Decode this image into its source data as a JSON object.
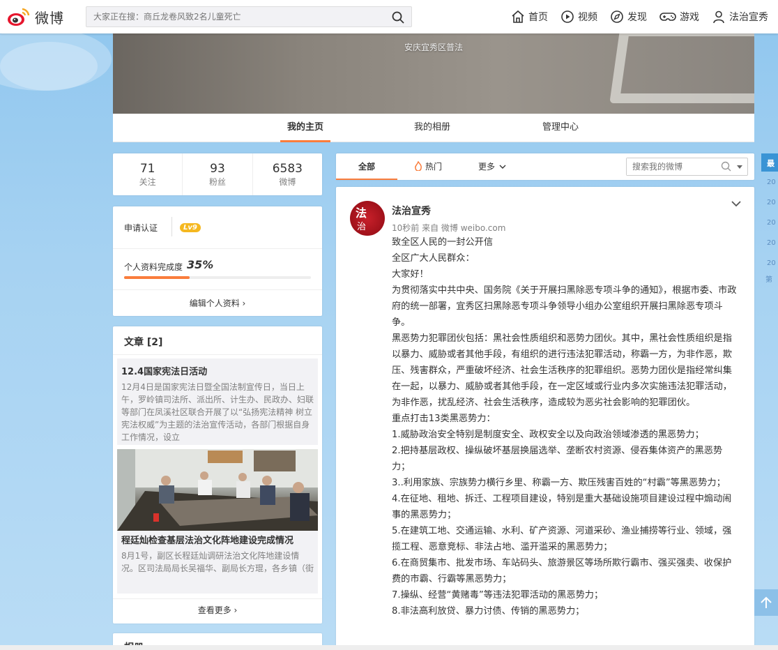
{
  "topbar": {
    "logo_text": "微博",
    "search_placeholder": "大家正在搜：商丘龙卷风致2名儿童死亡",
    "nav": [
      {
        "label": "首页",
        "icon": "home-icon"
      },
      {
        "label": "视频",
        "icon": "video-icon"
      },
      {
        "label": "发现",
        "icon": "compass-icon"
      },
      {
        "label": "游戏",
        "icon": "gamepad-icon"
      },
      {
        "label": "法治宣秀",
        "icon": "user-icon"
      }
    ]
  },
  "cover": {
    "subtitle": "安庆宜秀区普法"
  },
  "profile_tabs": {
    "home": "我的主页",
    "album": "我的相册",
    "manage": "管理中心"
  },
  "stats": {
    "following": {
      "value": "71",
      "label": "关注"
    },
    "fans": {
      "value": "93",
      "label": "粉丝"
    },
    "posts": {
      "value": "6583",
      "label": "微博"
    }
  },
  "profile_card": {
    "verify": "申请认证",
    "level": "Lv9",
    "completion_label": "个人资料完成度",
    "completion_value": "35%",
    "completion_fraction": 0.35,
    "edit": "编辑个人资料 ›"
  },
  "articles": {
    "title": "文章 [2]",
    "items": [
      {
        "title": "12.4国家宪法日活动",
        "excerpt": "12月4日是国家宪法日暨全国法制宣传日，当日上午，罗岭镇司法所、派出所、计生办、民政办、妇联等部门在凤溪社区联合开展了以“弘扬宪法精神 树立宪法权威”为主题的法治宣传活动，各部门根据自身工作情况，设立"
      },
      {
        "title": "程廷灿检查基层法治文化阵地建设完成情况",
        "excerpt": "8月1号，副区长程廷灿调研法治文化阵地建设情况。区司法局局长吴福华、副局长方琨，各乡镇（街"
      }
    ],
    "more": "查看更多 ›"
  },
  "next_card": {
    "title": "相册"
  },
  "feed": {
    "tabs": {
      "all": "全部",
      "hot": "热门",
      "more": "更多"
    },
    "search_placeholder": "搜索我的微博"
  },
  "post": {
    "author": "法治宣秀",
    "avatar_text_1": "法",
    "avatar_text_2": "治",
    "meta": "10秒前 来自 微博 weibo.com",
    "lines": [
      "致全区人民的一封公开信",
      "全区广大人民群众：",
      "大家好！",
      "为贯彻落实中共中央、国务院《关于开展扫黑除恶专项斗争的通知》，根据市委、市政府的统一部署，宜秀区扫黑除恶专项斗争领导小组办公室组织开展扫黑除恶专项斗争。",
      "黑恶势力犯罪团伙包括：黑社会性质组织和恶势力团伙。其中，黑社会性质组织是指以暴力、威胁或者其他手段，有组织的进行违法犯罪活动，称霸一方，为非作恶，欺压、残害群众，严重破坏经济、社会生活秩序的犯罪组织。恶势力团伙是指经常纠集在一起，以暴力、威胁或者其他手段，在一定区域或行业内多次实施违法犯罪活动，为非作恶，扰乱经济、社会生活秩序，造成较为恶劣社会影响的犯罪团伙。",
      "重点打击13类黑恶势力：",
      "1.威胁政治安全特别是制度安全、政权安全以及向政治领域渗透的黑恶势力；",
      "2.把持基层政权、操纵破坏基层换届选举、垄断农村资源、侵吞集体资产的黑恶势力；",
      "3..利用家族、宗族势力横行乡里、称霸一方、欺压残害百姓的“村霸”等黑恶势力；",
      "4.在征地、租地、拆迁、工程项目建设，特别是重大基础设施项目建设过程中煽动闹事的黑恶势力；",
      "5.在建筑工地、交通运输、水利、矿产资源、河道采砂、渔业捕捞等行业、领域，强揽工程、恶意竞标、非法占地、滥开滥采的黑恶势力；",
      "6.在商贸集市、批发市场、车站码头、旅游景区等场所欺行霸市、强买强卖、收保护费的市霸、行霸等黑恶势力；",
      "7.操纵、经营“黄赌毒”等违法犯罪活动的黑恶势力；",
      "8.非法高利放贷、暴力讨债、传销的黑恶势力；"
    ]
  },
  "sidebar_right": {
    "label": "最",
    "years": [
      "20",
      "20",
      "20",
      "20",
      "20"
    ],
    "next": "第"
  },
  "colors": {
    "accent": "#fa7d3c",
    "level_badge": "#f5b820",
    "link_blue": "#3a94d5"
  }
}
